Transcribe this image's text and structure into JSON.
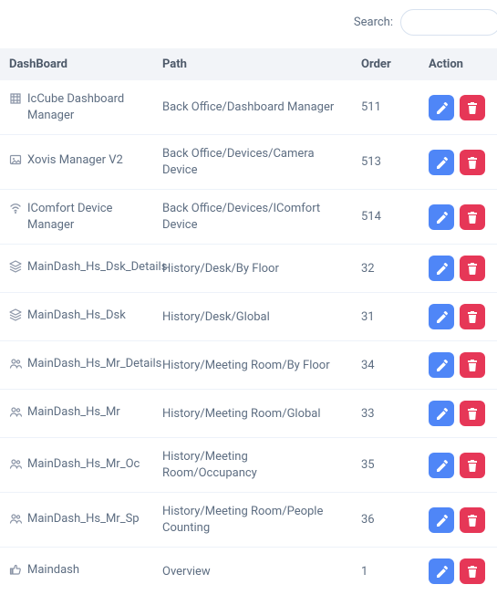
{
  "search": {
    "label": "Search:",
    "value": ""
  },
  "headers": {
    "dashboard": "DashBoard",
    "path": "Path",
    "order": "Order",
    "action": "Action"
  },
  "icons": {
    "edit": "edit-icon",
    "delete": "trash-icon"
  },
  "rows": [
    {
      "icon": "grid-icon",
      "name": "IcCube Dashboard Manager",
      "path": "Back Office/Dashboard Manager",
      "order": "511"
    },
    {
      "icon": "image-icon",
      "name": "Xovis Manager V2",
      "path": "Back Office/Devices/Camera Device",
      "order": "513"
    },
    {
      "icon": "wifi-icon",
      "name": "IComfort Device Manager",
      "path": "Back Office/Devices/IComfort Device",
      "order": "514"
    },
    {
      "icon": "layers-icon",
      "name": "MainDash_Hs_Dsk_Details",
      "path": "History/Desk/By Floor",
      "order": "32"
    },
    {
      "icon": "layers-icon",
      "name": "MainDash_Hs_Dsk",
      "path": "History/Desk/Global",
      "order": "31"
    },
    {
      "icon": "people-icon",
      "name": "MainDash_Hs_Mr_Details",
      "path": "History/Meeting Room/By Floor",
      "order": "34"
    },
    {
      "icon": "people-icon",
      "name": "MainDash_Hs_Mr",
      "path": "History/Meeting Room/Global",
      "order": "33"
    },
    {
      "icon": "people-icon",
      "name": "MainDash_Hs_Mr_Oc",
      "path": "History/Meeting Room/Occupancy",
      "order": "35"
    },
    {
      "icon": "people-icon",
      "name": "MainDash_Hs_Mr_Sp",
      "path": "History/Meeting Room/People Counting",
      "order": "36"
    },
    {
      "icon": "thumb-icon",
      "name": "Maindash",
      "path": "Overview",
      "order": "1"
    }
  ]
}
